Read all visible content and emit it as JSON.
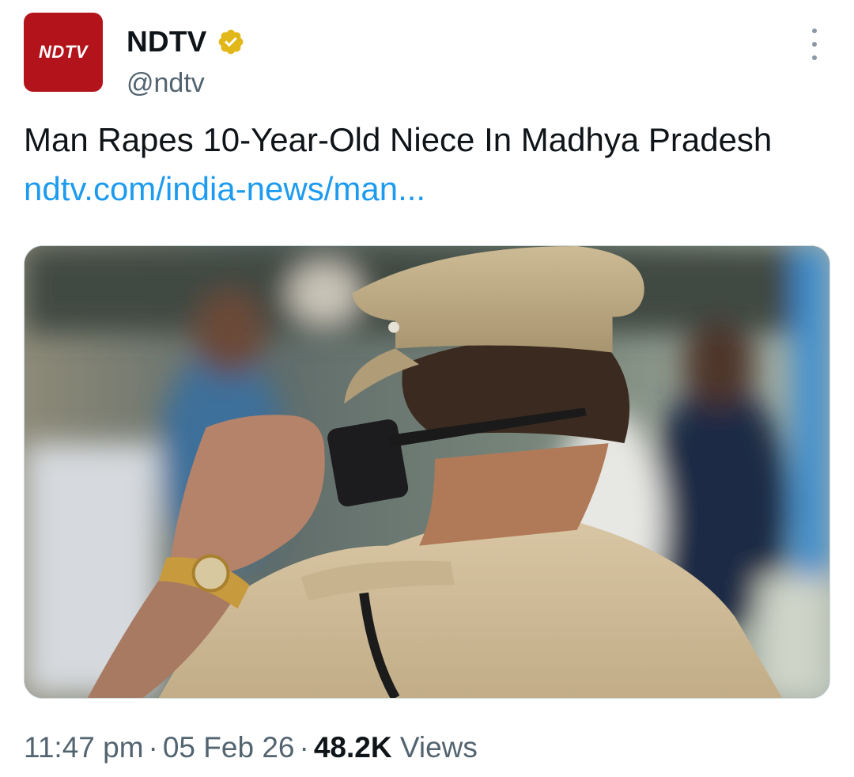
{
  "account": {
    "avatar_text": "NDTV",
    "display_name": "NDTV",
    "handle": "@ndtv",
    "verified": true,
    "avatar_color": "#b3141b",
    "badge_color": "#e2b719"
  },
  "tweet": {
    "text": "Man Rapes 10-Year-Old Niece In Madhya Pradesh ",
    "link_text": "ndtv.com/india-news/man...",
    "link_color": "#1d9bf0"
  },
  "meta": {
    "time": "11:47 pm",
    "date": "05 Feb 26",
    "views_count": "48.2K",
    "views_label": "Views",
    "separator": "·"
  },
  "icons": {
    "more": "more-vertical-icon",
    "verified": "verified-badge-icon"
  }
}
